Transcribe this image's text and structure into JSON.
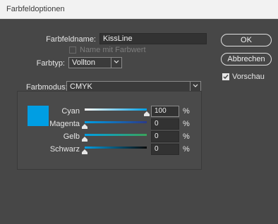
{
  "window": {
    "title": "Farbfeldoptionen"
  },
  "form": {
    "name_label": "Farbfeldname:",
    "name_value": "KissLine",
    "name_with_value_label": "Name mit Farbwert",
    "type_label": "Farbtyp:",
    "type_value": "Vollton",
    "mode_label": "Farbmodus:",
    "mode_value": "CMYK"
  },
  "buttons": {
    "ok": "OK",
    "cancel": "Abbrechen"
  },
  "preview": {
    "label": "Vorschau",
    "checked": true
  },
  "swatch_color": "#009ee3",
  "sliders": [
    {
      "label": "Cyan",
      "value": "100",
      "unit": "%",
      "fraction": 1.0
    },
    {
      "label": "Magenta",
      "value": "0",
      "unit": "%",
      "fraction": 0.0
    },
    {
      "label": "Gelb",
      "value": "0",
      "unit": "%",
      "fraction": 0.0
    },
    {
      "label": "Schwarz",
      "value": "0",
      "unit": "%",
      "fraction": 0.0
    }
  ]
}
